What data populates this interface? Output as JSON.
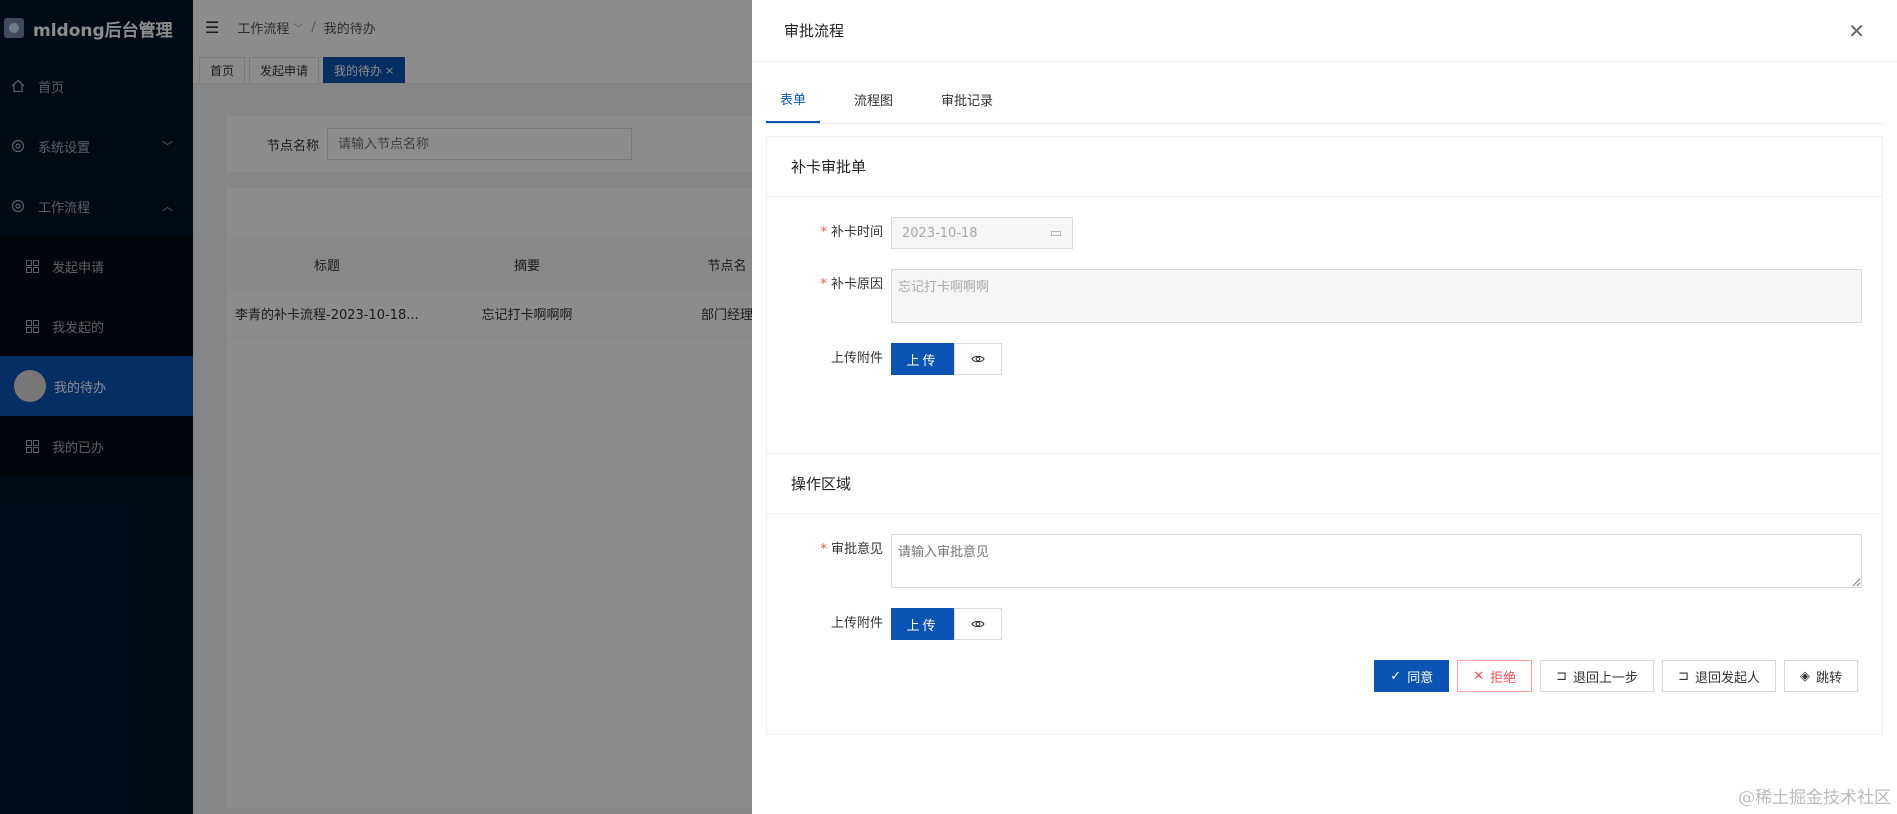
{
  "sidebar": {
    "logo_text": "mldong后台管理",
    "items": [
      {
        "label": "首页",
        "icon": "home-icon"
      },
      {
        "label": "系统设置",
        "icon": "gear-icon"
      },
      {
        "label": "工作流程",
        "icon": "gear-icon"
      }
    ],
    "submenu": [
      {
        "label": "发起申请",
        "icon": "grid-icon"
      },
      {
        "label": "我发起的",
        "icon": "grid-icon"
      },
      {
        "label": "我的待办",
        "icon": "avatar"
      },
      {
        "label": "我的已办",
        "icon": "grid-icon"
      }
    ]
  },
  "header": {
    "breadcrumb_1": "工作流程",
    "breadcrumb_2": "我的待办"
  },
  "page_tabs": [
    {
      "label": "首页"
    },
    {
      "label": "发起申请"
    },
    {
      "label": "我的待办",
      "close": "×"
    }
  ],
  "search": {
    "label": "节点名称",
    "placeholder": "请输入节点名称"
  },
  "table": {
    "columns": [
      "标题",
      "摘要",
      "节点名"
    ],
    "row": [
      "李青的补卡流程-2023-10-18...",
      "忘记打卡啊啊啊",
      "部门经理"
    ]
  },
  "drawer": {
    "title": "审批流程",
    "tabs": [
      "表单",
      "流程图",
      "审批记录"
    ],
    "form_card": {
      "title": "补卡审批单",
      "time_label": "补卡时间",
      "time_value": "2023-10-18",
      "reason_label": "补卡原因",
      "reason_value": "忘记打卡啊啊啊",
      "attach_label": "上传附件",
      "upload_label": "上传"
    },
    "action_card": {
      "title": "操作区域",
      "opinion_label": "审批意见",
      "opinion_placeholder": "请输入审批意见",
      "attach_label": "上传附件",
      "upload_label": "上传"
    },
    "buttons": {
      "agree": "同意",
      "reject": "拒绝",
      "back_prev": "退回上一步",
      "back_initiator": "退回发起人",
      "jump": "跳转"
    }
  },
  "watermark": "@稀土掘金技术社区",
  "colors": {
    "primary": "#0b54b4",
    "sidebar": "#001529",
    "danger": "#ff4d4f"
  }
}
